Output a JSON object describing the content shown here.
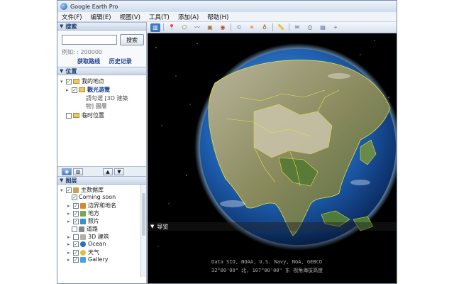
{
  "window": {
    "title": "Google Earth Pro"
  },
  "menu": [
    "文件(F)",
    "编辑(E)",
    "视图(V)",
    "工具(T)",
    "添加(A)",
    "帮助(H)"
  ],
  "search": {
    "header": "搜索",
    "button": "搜索",
    "example": "例如: : 200000",
    "get_directions": "获取路线",
    "history": "历史记录"
  },
  "places": {
    "header": "位置",
    "my_places": "我的地点",
    "sightseeing": "觀光游覽",
    "sightseeing_note_1": "請勾選 [3D 建築",
    "sightseeing_note_2": "物] 圖層",
    "temporary": "临时位置"
  },
  "layers": {
    "header": "图层",
    "items": [
      {
        "label": "主数据库",
        "color": "#c9a24a"
      },
      {
        "label": "Coming soon",
        "color": ""
      },
      {
        "label": "边界和地名",
        "color": "#d68a2a"
      },
      {
        "label": "地方",
        "color": "#7aa84a"
      },
      {
        "label": "照片",
        "color": "#3a8fd0"
      },
      {
        "label": "道路",
        "color": "#888888"
      },
      {
        "label": "3D 建筑",
        "color": "#b0b0b0"
      },
      {
        "label": "Ocean",
        "color": "#2a6fc0"
      },
      {
        "label": "天气",
        "color": "#e0c040"
      },
      {
        "label": "Gallery",
        "color": "#4aa0e0"
      }
    ]
  },
  "viewport": {
    "nav_label": "导览",
    "status_line_1": "Data SIO, NOAA, U.S. Navy, NGA, GEBCO",
    "status_line_2": "32°00'00\" 北, 107°00'00\" 东  视角海拔高度"
  },
  "colors": {
    "accent": "#1f3f74",
    "link": "#1a3d8f",
    "globe_ocean": "#1e5fb0",
    "boundary": "#e8e040"
  }
}
